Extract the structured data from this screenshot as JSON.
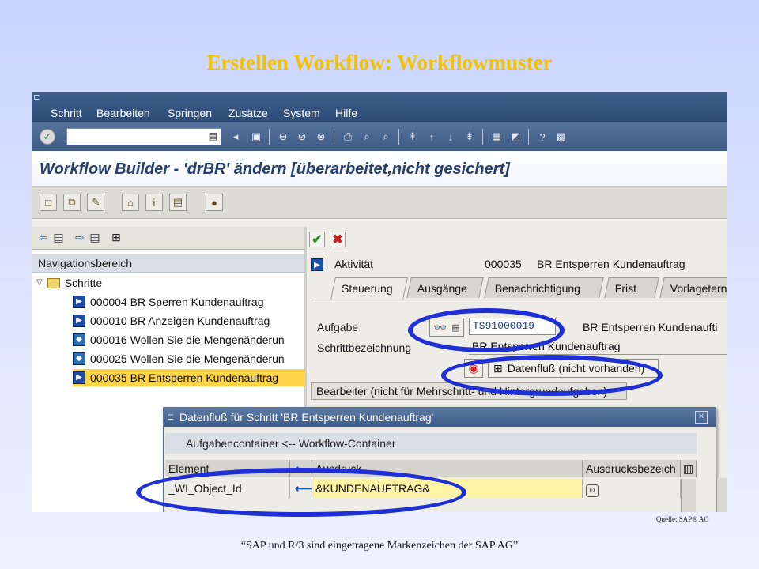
{
  "slide": {
    "title": "Erstellen Workflow: Workflowmuster",
    "source": "Quelle: SAP® AG",
    "footer": "“SAP und R/3 sind eingetragene Markenzeichen der SAP AG”"
  },
  "menubar": {
    "items": [
      "Schritt",
      "Bearbeiten",
      "Springen",
      "Zusätze",
      "System",
      "Hilfe"
    ]
  },
  "command_field": {
    "value": ""
  },
  "window_title": "Workflow Builder - 'drBR' ändern [überarbeitet,nicht gesichert]",
  "navigation": {
    "header": "Navigationsbereich",
    "root": "Schritte",
    "items": [
      {
        "label": "000004 BR Sperren Kundenauftrag",
        "selected": false
      },
      {
        "label": "000010 BR Anzeigen Kundenauftrag",
        "selected": false
      },
      {
        "label": "000016 Wollen Sie die Mengenänderun",
        "selected": false
      },
      {
        "label": "000025 Wollen Sie die Mengenänderun",
        "selected": false
      },
      {
        "label": "000035 BR Entsperren Kundenauftrag",
        "selected": true
      }
    ]
  },
  "detail": {
    "type_label": "Aktivität",
    "step_number": "000035",
    "step_name": "BR Entsperren Kundenauftrag",
    "tabs": [
      "Steuerung",
      "Ausgänge",
      "Benachrichtigung",
      "Frist",
      "Vorlagetern"
    ],
    "active_tab": "Steuerung",
    "task_label": "Aufgabe",
    "task_value": "TS91000019",
    "task_desc": "BR Entsperren Kundenaufti",
    "step_desc_label": "Schrittbezeichnung",
    "step_desc_value": "BR Entsperren Kundenauftrag",
    "dataflow_button": "Datenfluß (nicht vorhanden)",
    "agent_group": "Bearbeiter (nicht für Mehrschritt- und Hintergrundaufgaben)"
  },
  "dialog": {
    "title": "Datenfluß für Schritt 'BR Entsperren Kundenauftrag'",
    "subheader": "Aufgabencontainer  <--  Workflow-Container",
    "columns": [
      "Element",
      "Ausdruck",
      "Ausdrucksbezeich"
    ],
    "rows": [
      {
        "element": "_WI_Object_Id",
        "expression": "&KUNDENAUFTRAG&",
        "description": ""
      }
    ]
  },
  "colors": {
    "title_yellow": "#f2c200",
    "highlight_blue": "#1f2fd6",
    "selection": "#ffd447",
    "sap_blue": "#3e5f8c"
  }
}
